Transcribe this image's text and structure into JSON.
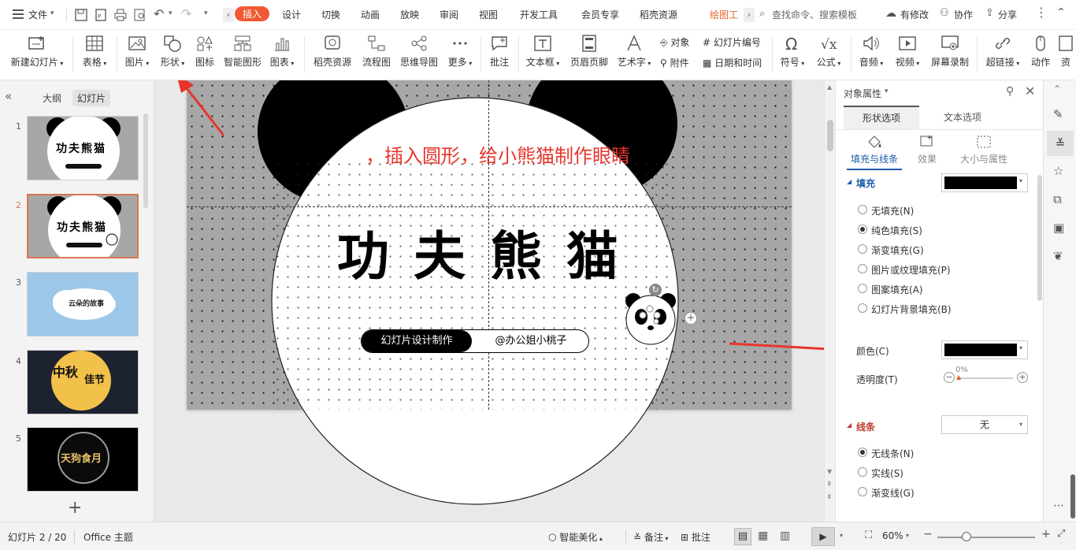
{
  "menubar": {
    "file": "文件",
    "tabs": [
      "插入",
      "设计",
      "切换",
      "动画",
      "放映",
      "审阅",
      "视图",
      "开发工具",
      "会员专享",
      "稻壳资源",
      "绘图工"
    ],
    "search_placeholder": "查找命令、搜索模板",
    "changes": "有修改",
    "collab": "协作",
    "share": "分享"
  },
  "ribbon": {
    "new_slide": "新建幻灯片",
    "table": "表格",
    "picture": "图片",
    "shape": "形状",
    "icon": "图标",
    "smart": "智能图形",
    "chart": "图表",
    "docer": "稻壳资源",
    "flow": "流程图",
    "mind": "思维导图",
    "more": "更多",
    "comment": "批注",
    "textbox": "文本框",
    "header": "页眉页脚",
    "art": "艺术字",
    "object": "对象",
    "attach": "附件",
    "slide_num": "幻灯片编号",
    "datetime": "日期和时间",
    "symbol": "符号",
    "formula": "公式",
    "audio": "音频",
    "video": "视频",
    "record": "屏幕录制",
    "link": "超链接",
    "action": "动作",
    "cut": "资"
  },
  "left": {
    "outline": "大纲",
    "slides": "幻灯片",
    "thumb1": "功夫熊猫",
    "thumb3": "云朵的故事",
    "thumb4a": "中秋",
    "thumb4b": "佳节",
    "thumb5": "天狗食月",
    "numbers": [
      "1",
      "2",
      "3",
      "4",
      "5"
    ]
  },
  "slide": {
    "annotation": "，插入圆形，给小熊猫制作眼睛",
    "title": "功 夫 熊 猫",
    "pill_left": "幻灯片设计制作",
    "pill_right": "@办公姐小桃子"
  },
  "panel": {
    "title": "对象属性",
    "tab_shape": "形状选项",
    "tab_text": "文本选项",
    "sub_fill": "填充与线条",
    "sub_effect": "效果",
    "sub_size": "大小与属性",
    "fill_header": "填充",
    "fill_options": [
      "无填充(N)",
      "纯色填充(S)",
      "渐变填充(G)",
      "图片或纹理填充(P)",
      "图案填充(A)",
      "幻灯片背景填充(B)"
    ],
    "color_label": "颜色(C)",
    "transparency_label": "透明度(T)",
    "transparency_value": "0%",
    "line_header": "线条",
    "line_value": "无",
    "line_options": [
      "无线条(N)",
      "实线(S)",
      "渐变线(G)"
    ],
    "fill_color": "#000000"
  },
  "status": {
    "slide_info": "幻灯片 2 / 20",
    "theme": "Office 主题",
    "beautify": "智能美化",
    "notes": "备注",
    "comment": "批注",
    "zoom": "60%"
  },
  "colors": {
    "accent": "#f05a33",
    "arrow": "#e8352c",
    "selected_border": "#d9764c"
  }
}
